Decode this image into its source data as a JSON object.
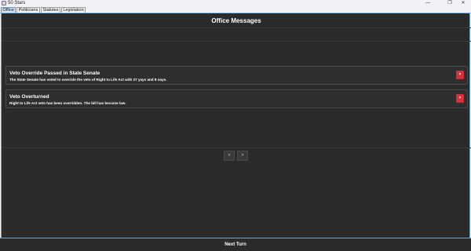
{
  "window": {
    "title": "50 Stars",
    "minimize": "—",
    "maximize": "❐",
    "close": "✕"
  },
  "tabs": [
    {
      "label": "Office"
    },
    {
      "label": "Politicians"
    },
    {
      "label": "Statutes"
    },
    {
      "label": "Legislation"
    }
  ],
  "main": {
    "heading": "Office Messages",
    "messages": [
      {
        "title": "Veto Override Passed in State Senate",
        "body": "The State Senate has voted to override the veto of Right to Life Act with 27 yays and 8 nays.",
        "dismiss": "×"
      },
      {
        "title": "Veto Overturned",
        "body": "Right to Life Act veto has been overridden. The bill has become law.",
        "dismiss": "×"
      }
    ],
    "pager": {
      "prev": "<",
      "next": ">"
    }
  },
  "footer": {
    "next_turn": "Next Turn"
  },
  "colors": {
    "accent": "#6aa8da",
    "dismiss": "#d4303a",
    "panel": "#2b2b2b"
  }
}
